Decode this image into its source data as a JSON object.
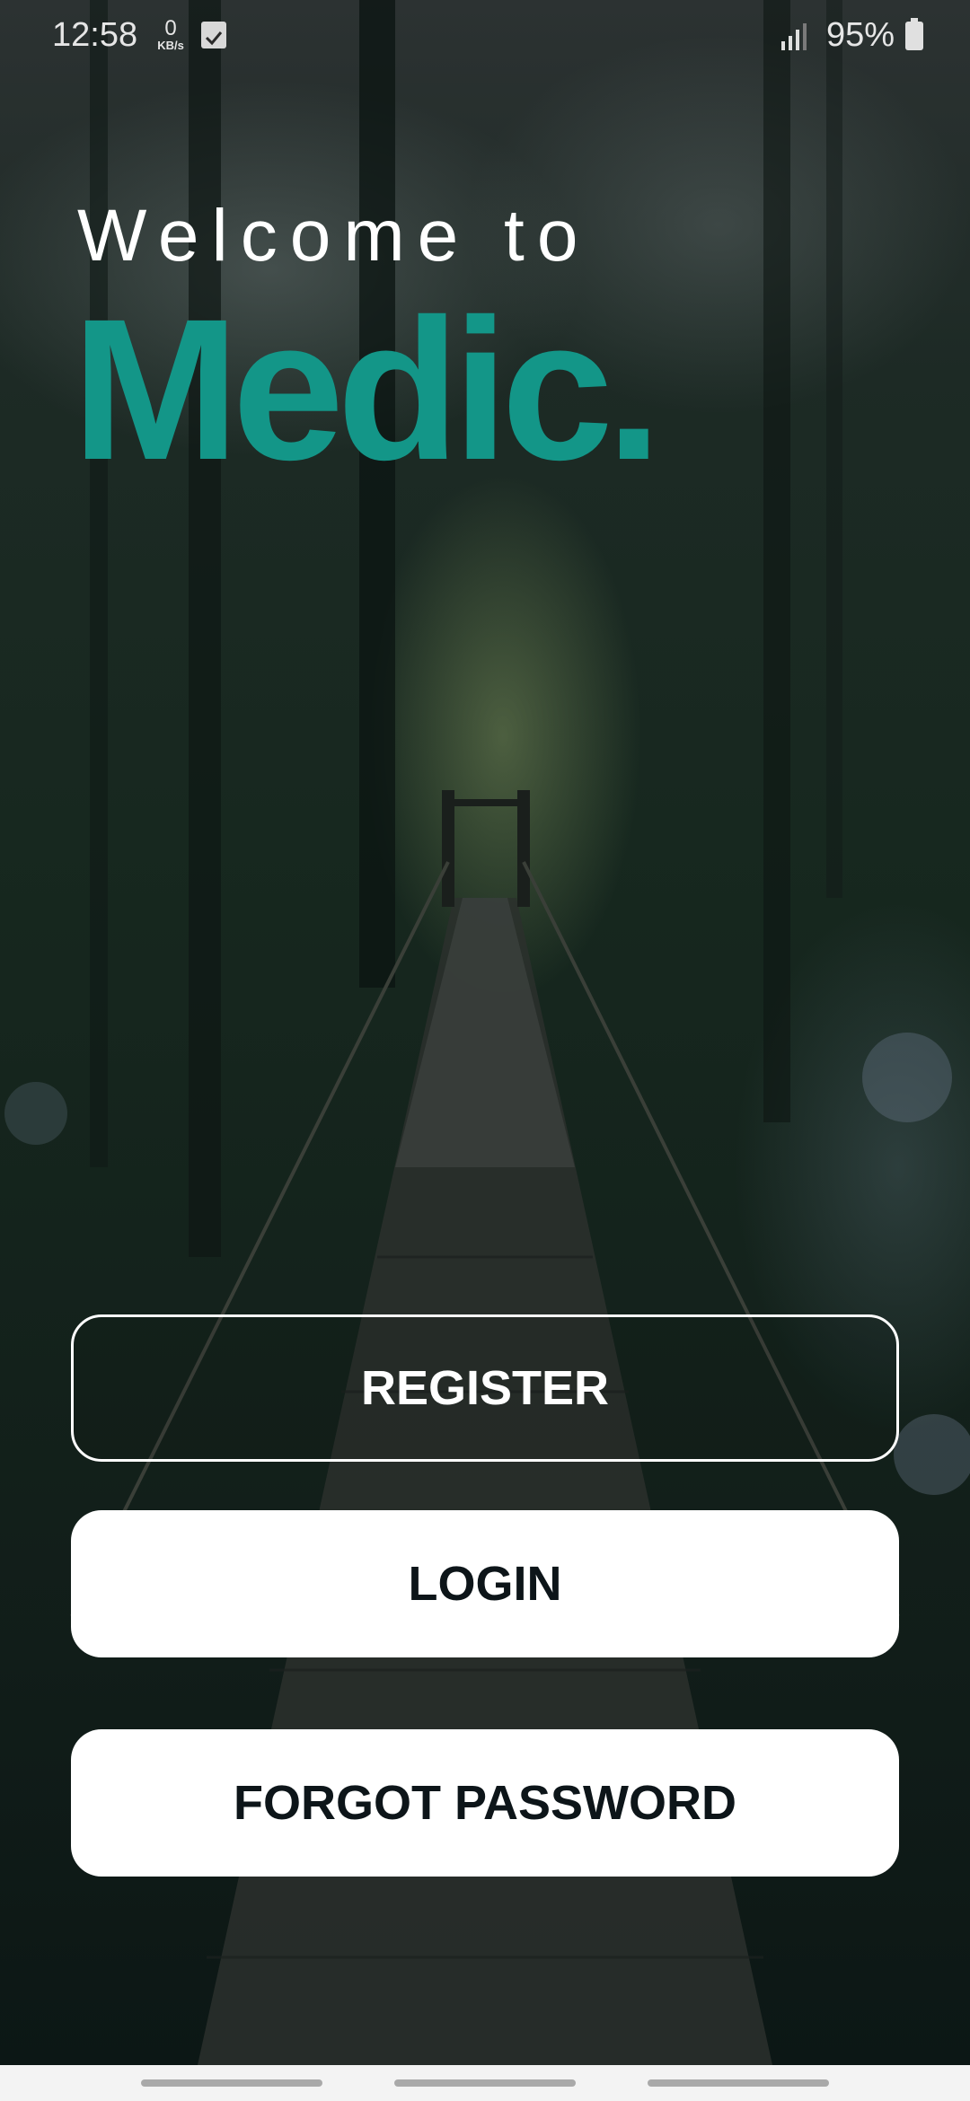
{
  "status_bar": {
    "time": "12:58",
    "net_speed_value": "0",
    "net_speed_unit": "KB/s",
    "battery_percent": "95%"
  },
  "welcome": {
    "line1": "Welcome to",
    "brand": "Medic."
  },
  "buttons": {
    "register": "REGISTER",
    "login": "LOGIN",
    "forgot_password": "FORGOT PASSWORD"
  },
  "colors": {
    "brand": "#139688",
    "button_text": "#0d1519",
    "button_bg": "#ffffff"
  },
  "icons": {
    "check": "check-box-icon",
    "signal": "signal-icon",
    "battery": "battery-icon"
  }
}
